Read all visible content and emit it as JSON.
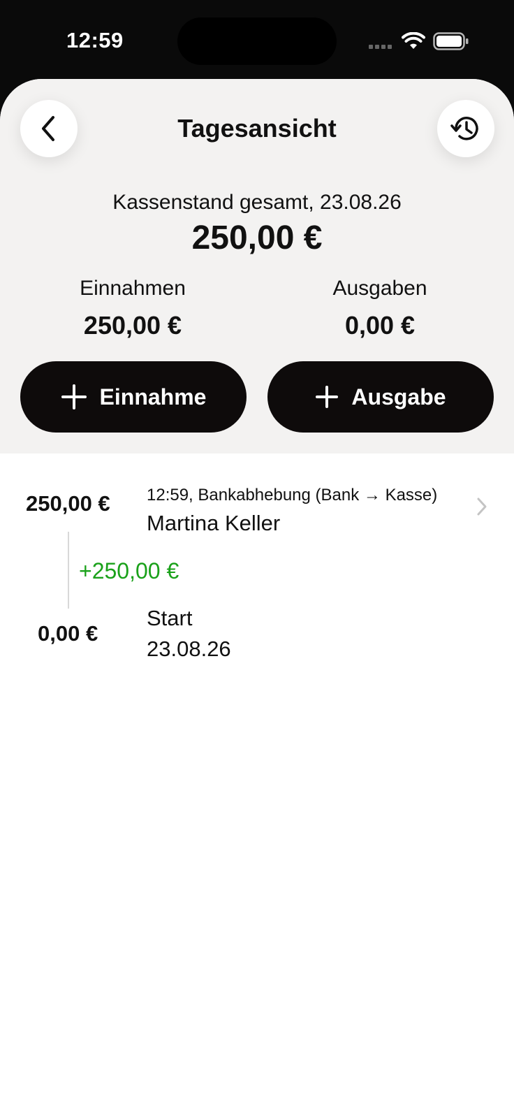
{
  "status_bar": {
    "time": "12:59"
  },
  "header": {
    "title": "Tagesansicht",
    "back_icon": "chevron-left-icon",
    "history_icon": "history-icon"
  },
  "summary": {
    "total_label": "Kassenstand gesamt, 23.08.26",
    "total_value": "250,00 €",
    "income_label": "Einnahmen",
    "income_value": "250,00 €",
    "expense_label": "Ausgaben",
    "expense_value": "0,00 €"
  },
  "actions": {
    "add_income_label": "Einnahme",
    "add_expense_label": "Ausgabe"
  },
  "transactions": [
    {
      "balance": "250,00 €",
      "meta": "12:59, Bankabhebung (Bank → Kasse)",
      "name": "Martina Keller",
      "delta": "+250,00 €"
    }
  ],
  "start": {
    "balance": "0,00 €",
    "label": "Start",
    "date": "23.08.26"
  },
  "colors": {
    "accent_dark": "#0e0b0b",
    "summary_bg": "#f3f2f1",
    "positive": "#1aa11a"
  }
}
